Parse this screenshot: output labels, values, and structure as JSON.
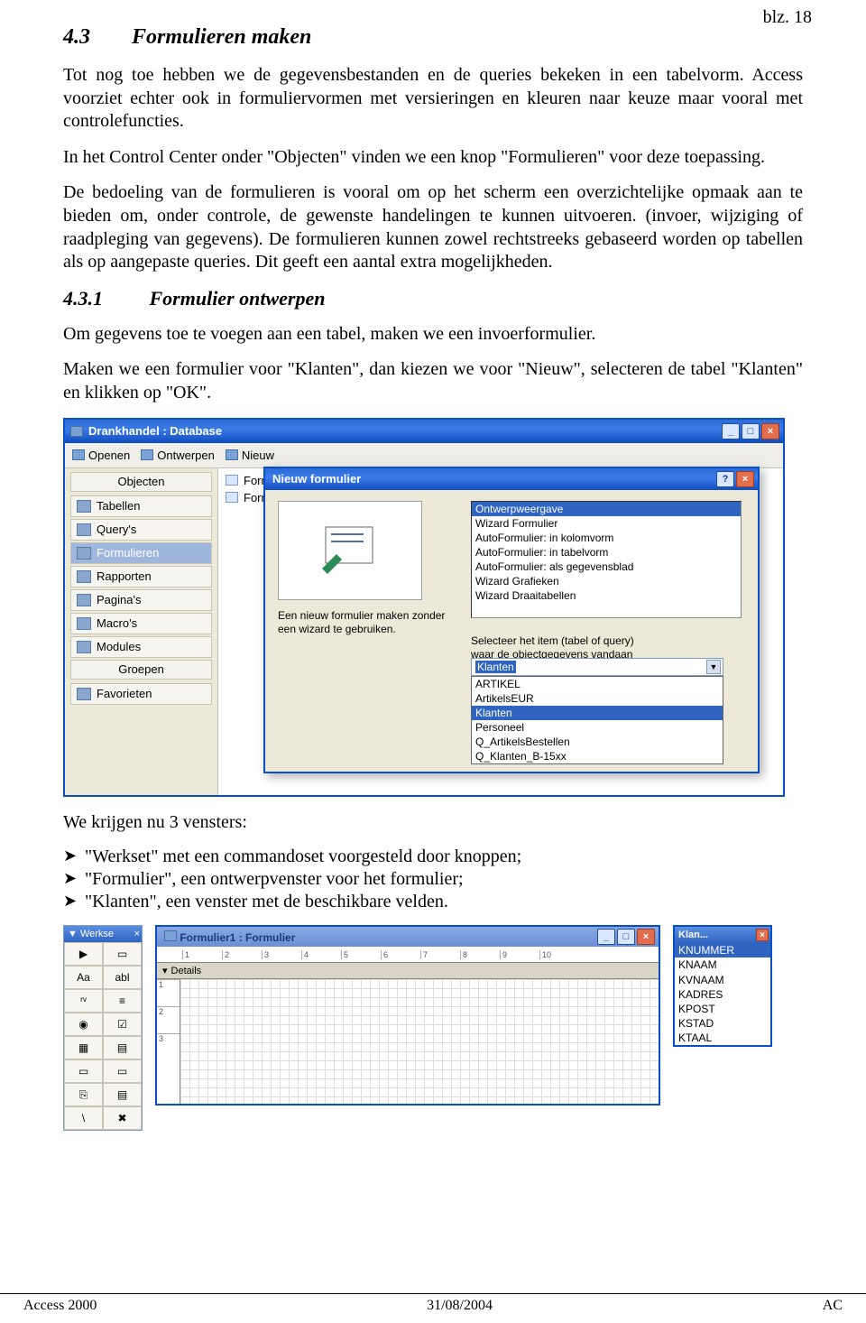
{
  "page_number": "blz. 18",
  "section_heading": {
    "num": "4.3",
    "title": "Formulieren maken"
  },
  "para1": "Tot nog toe hebben we de gegevensbestanden en de queries bekeken in een tabelvorm. Access voorziet echter ook in formuliervormen met versieringen en kleuren naar keuze maar vooral met controlefuncties.",
  "para2": "In het Control Center onder \"Objecten\" vinden we een knop \"Formulieren\" voor deze toepassing.",
  "para3": "De bedoeling van de formulieren is vooral om op het scherm een overzichtelijke opmaak aan te bieden om, onder controle, de gewenste handelingen te kunnen uitvoeren. (invoer, wijziging of raadpleging van gegevens). De formulieren kunnen zowel rechtstreeks gebaseerd worden op tabellen als op aangepaste queries. Dit geeft een aantal extra mogelijkheden.",
  "sub_heading": {
    "num": "4.3.1",
    "title": "Formulier ontwerpen"
  },
  "para4": "Om gegevens toe te voegen aan een tabel, maken we een invoerformulier.",
  "para5": "Maken we een formulier voor \"Klanten\", dan kiezen we voor \"Nieuw\", selecteren de tabel \"Klanten\" en klikken op \"OK\".",
  "db_window": {
    "title": "Drankhandel : Database",
    "toolbar": {
      "open": "Openen",
      "ontwerpen": "Ontwerpen",
      "nieuw": "Nieuw"
    },
    "sidebar": {
      "header": "Objecten",
      "items": [
        "Tabellen",
        "Query's",
        "Formulieren",
        "Rapporten",
        "Pagina's",
        "Macro's",
        "Modules"
      ],
      "groepen": "Groepen",
      "fav": "Favorieten",
      "selected_index": 2
    },
    "main_list": [
      "Formulier m",
      "Formulier m"
    ]
  },
  "dialog": {
    "title": "Nieuw formulier",
    "desc": "Een nieuw formulier maken zonder een wizard te gebruiken.",
    "options": [
      "Ontwerpweergave",
      "Wizard Formulier",
      "AutoFormulier: in kolomvorm",
      "AutoFormulier: in tabelvorm",
      "AutoFormulier: als gegevensblad",
      "Wizard Grafieken",
      "Wizard Draaitabellen"
    ],
    "options_selected_index": 0,
    "select_label": "Selecteer het item (tabel of query) waar de objectgegevens vandaan komen:",
    "combo_value": "Klanten",
    "dropdown": [
      "ARTIKEL",
      "ArtikelsEUR",
      "Klanten",
      "Personeel",
      "Q_ArtikelsBestellen",
      "Q_Klanten_B-15xx"
    ],
    "dropdown_selected_index": 2
  },
  "post_text": "We krijgen nu 3 vensters:",
  "bullets": [
    "\"Werkset\" met een commandoset voorgesteld door knoppen;",
    "\"Formulier\", een ontwerpvenster voor het formulier;",
    "\"Klanten\", een venster met de beschikbare velden."
  ],
  "werkset": {
    "title": "Werkse",
    "tools": [
      "▶",
      "▭",
      "Aa",
      "abl",
      "ʳᵛ",
      "≡",
      "◉",
      "☑",
      "▦",
      "▤",
      "▭",
      "▭",
      "⎘",
      "▤",
      "\\",
      "✖"
    ]
  },
  "formwin": {
    "title": "Formulier1 : Formulier",
    "ruler": [
      "1",
      "2",
      "3",
      "4",
      "5",
      "6",
      "7",
      "8",
      "9",
      "10"
    ],
    "vruler": [
      "1",
      "2",
      "3"
    ],
    "details": "Details"
  },
  "klan": {
    "title": "Klan...",
    "fields": [
      "KNUMMER",
      "KNAAM",
      "KVNAAM",
      "KADRES",
      "KPOST",
      "KSTAD",
      "KTAAL"
    ],
    "selected_index": 0
  },
  "footer": {
    "left": "Access 2000",
    "center": "31/08/2004",
    "right": "AC"
  }
}
